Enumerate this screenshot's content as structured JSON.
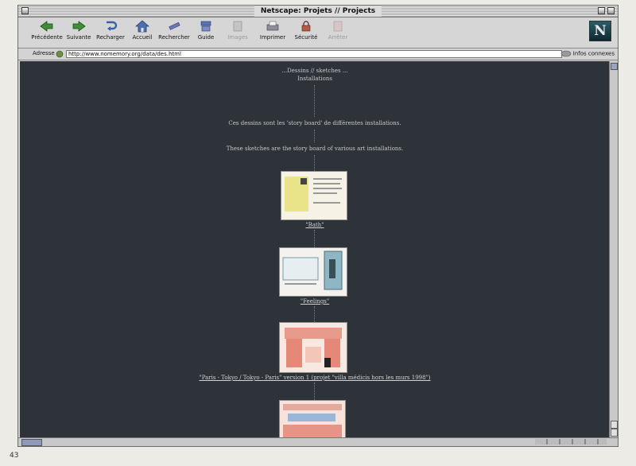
{
  "window": {
    "title": "Netscape: Projets // Projects"
  },
  "toolbar": {
    "buttons": [
      {
        "label": "Précédente",
        "icon": "back-icon"
      },
      {
        "label": "Suivante",
        "icon": "forward-icon"
      },
      {
        "label": "Recharger",
        "icon": "reload-icon"
      },
      {
        "label": "Accueil",
        "icon": "home-icon"
      },
      {
        "label": "Rechercher",
        "icon": "search-icon"
      },
      {
        "label": "Guide",
        "icon": "guide-icon"
      },
      {
        "label": "Images",
        "icon": "images-icon"
      },
      {
        "label": "Imprimer",
        "icon": "print-icon"
      },
      {
        "label": "Sécurité",
        "icon": "lock-icon"
      },
      {
        "label": "Arrêter",
        "icon": "stop-icon"
      }
    ],
    "logo": "N"
  },
  "address": {
    "label": "Adresse",
    "url": "http://www.nomemory.org/data/des.html",
    "related": "Infos connexes"
  },
  "page": {
    "heading1": "...Dessins // sketches ...",
    "heading2": "Installations",
    "fr_text": "Ces dessins sont les 'story board' de différentes installations.",
    "en_text": "These sketches are the story board of various art installations.",
    "link_bath": "\"Bath\"",
    "link_feelings": "\"Feelings\"",
    "link_paris": "\"Paris - Tokyo / Tokyo - Paris\" version 1 (projet \"villa médicis hors les murs 1998\")"
  },
  "book": {
    "page_number": "43"
  },
  "colors": {
    "content_bg": "#2e3339",
    "chrome": "#d6d6d6"
  }
}
